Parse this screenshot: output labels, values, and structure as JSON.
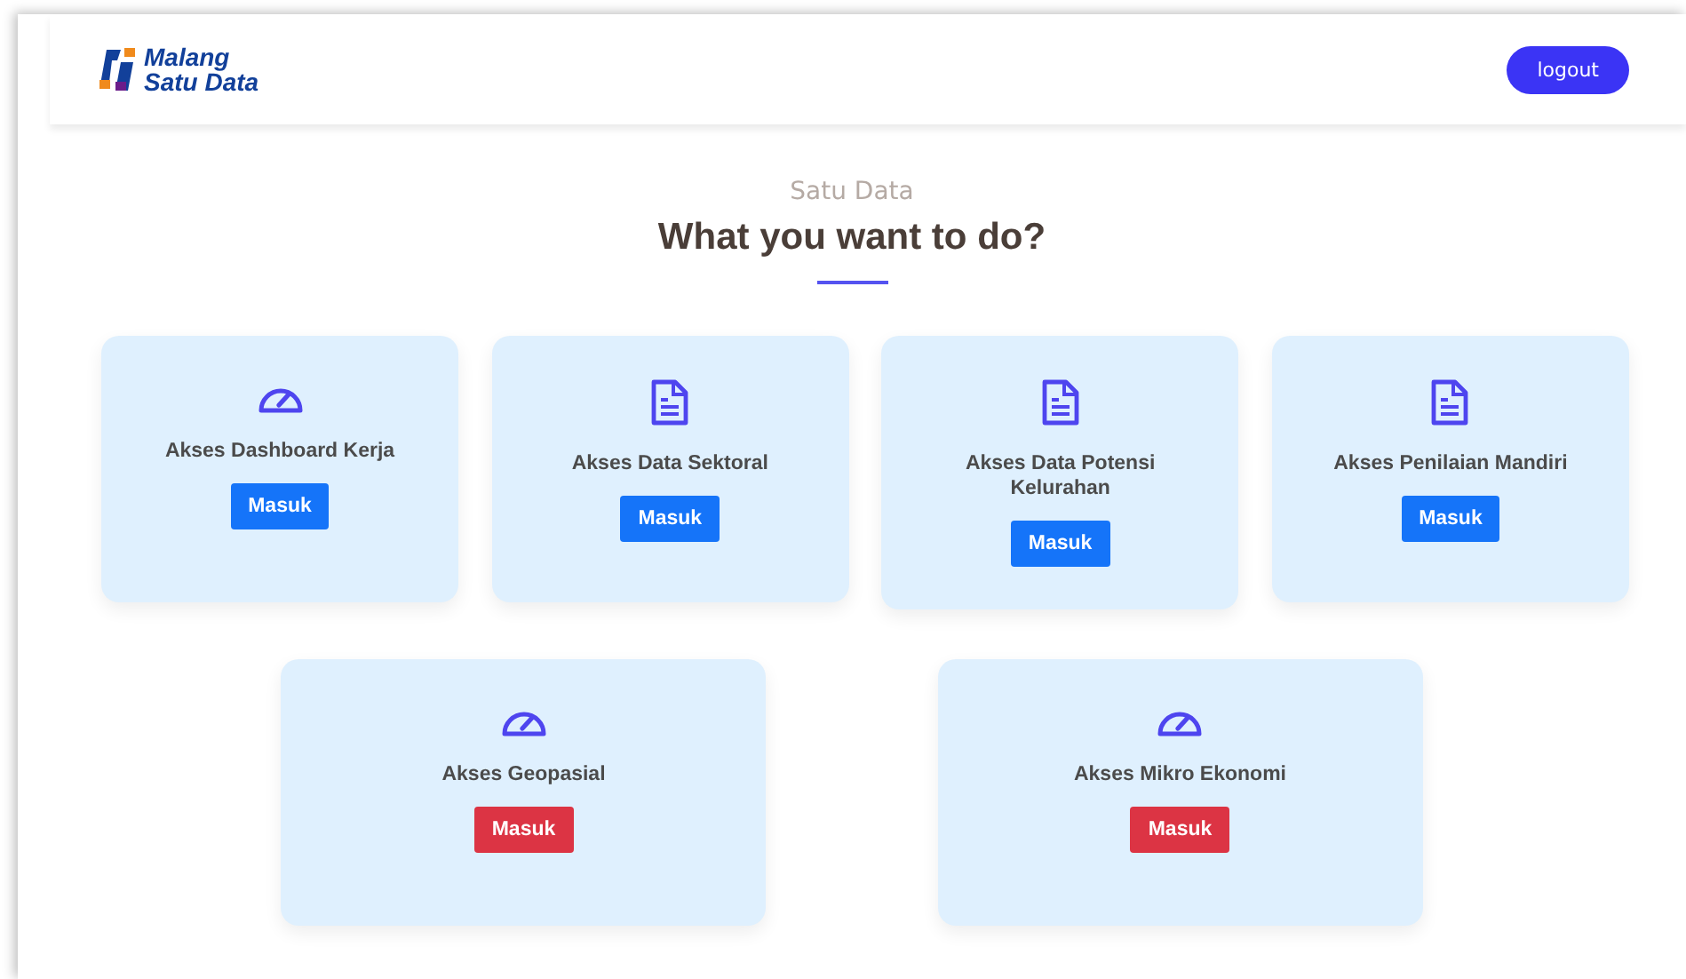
{
  "header": {
    "logo_lines": [
      "Malang",
      "Satu Data"
    ],
    "logout": "logout"
  },
  "intro": {
    "eyebrow": "Satu Data",
    "title": "What you want to do?"
  },
  "card_rows": [
    {
      "cards": [
        {
          "kind": "gauge",
          "title": "Akses Dashboard Kerja",
          "button": "Masuk",
          "color": "#1574f9"
        },
        {
          "kind": "document",
          "title": "Akses Data Sektoral",
          "button": "Masuk",
          "color": "#1574f9"
        },
        {
          "kind": "document",
          "title": "Akses Data Potensi Kelurahan",
          "button": "Masuk",
          "color": "#1574f9"
        },
        {
          "kind": "document",
          "title": "Akses Penilaian Mandiri",
          "button": "Masuk",
          "color": "#1574f9"
        }
      ]
    },
    {
      "cards": [
        {
          "kind": "gauge",
          "title": "Akses Geopasial",
          "button": "Masuk",
          "color": "#dc3444"
        },
        {
          "kind": "gauge",
          "title": "Akses Mikro Ekonomi",
          "button": "Masuk",
          "color": "#dc3444"
        }
      ]
    }
  ]
}
